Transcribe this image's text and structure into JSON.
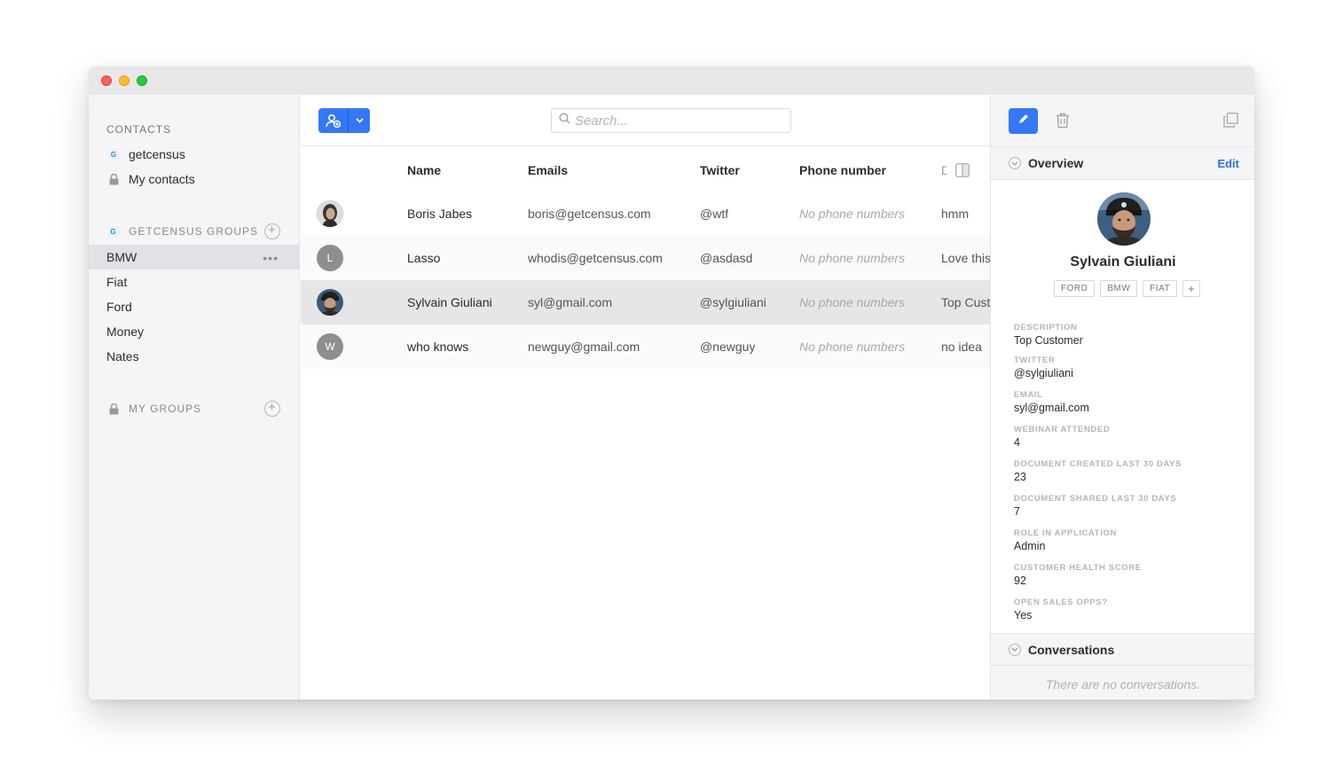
{
  "sidebar": {
    "contacts_title": "CONTACTS",
    "sources": [
      {
        "label": "getcensus",
        "icon": "g-badge-icon",
        "badge": "G"
      },
      {
        "label": "My contacts",
        "icon": "lock-icon"
      }
    ],
    "getcensus_groups_title": "GETCENSUS GROUPS",
    "groups": [
      {
        "label": "BMW",
        "selected": true
      },
      {
        "label": "Fiat"
      },
      {
        "label": "Ford"
      },
      {
        "label": "Money"
      },
      {
        "label": "Nates"
      }
    ],
    "more_label": "•••",
    "my_groups_title": "MY GROUPS"
  },
  "toolbar": {
    "search_placeholder": "Search..."
  },
  "table": {
    "columns": [
      "Name",
      "Emails",
      "Twitter",
      "Phone number",
      "D"
    ],
    "rows": [
      {
        "avatar": "photo",
        "initial": "",
        "name": "Boris Jabes",
        "email": "boris@getcensus.com",
        "twitter": "@wtf",
        "phone": "No phone numbers",
        "desc": "hmm"
      },
      {
        "avatar": "letter",
        "initial": "L",
        "name": "Lasso",
        "email": "whodis@getcensus.com",
        "twitter": "@asdasd",
        "phone": "No phone numbers",
        "desc": "Love this"
      },
      {
        "avatar": "photo",
        "initial": "",
        "name": "Sylvain Giuliani",
        "email": "syl@gmail.com",
        "twitter": "@sylgiuliani",
        "phone": "No phone numbers",
        "desc": "Top Customer",
        "selected": true
      },
      {
        "avatar": "letter",
        "initial": "W",
        "name": "who knows",
        "email": "newguy@gmail.com",
        "twitter": "@newguy",
        "phone": "No phone numbers",
        "desc": "no idea"
      }
    ]
  },
  "panel": {
    "overview_label": "Overview",
    "edit_label": "Edit",
    "name": "Sylvain Giuliani",
    "tags": [
      "FORD",
      "BMW",
      "FIAT"
    ],
    "add_tag": "+",
    "fields": [
      {
        "key": "DESCRIPTION",
        "value": "Top Customer"
      },
      {
        "key": "TWITTER",
        "value": "@sylgiuliani"
      },
      {
        "key": "EMAIL",
        "value": "syl@gmail.com"
      },
      {
        "key": "WEBINAR ATTENDED",
        "value": "4"
      },
      {
        "key": "DOCUMENT CREATED LAST 30 DAYS",
        "value": "23"
      },
      {
        "key": "DOCUMENT SHARED LAST 30 DAYS",
        "value": "7"
      },
      {
        "key": "ROLE IN APPLICATION",
        "value": "Admin"
      },
      {
        "key": "CUSTOMER HEALTH SCORE",
        "value": "92"
      },
      {
        "key": "OPEN SALES OPPS?",
        "value": "Yes"
      }
    ],
    "conversations_label": "Conversations",
    "no_conversations": "There are no conversations."
  },
  "colors": {
    "accent": "#3478f6",
    "link": "#2a72d9",
    "selected_row": "#e6e6e9",
    "sidebar_bg": "#f5f5f7"
  }
}
